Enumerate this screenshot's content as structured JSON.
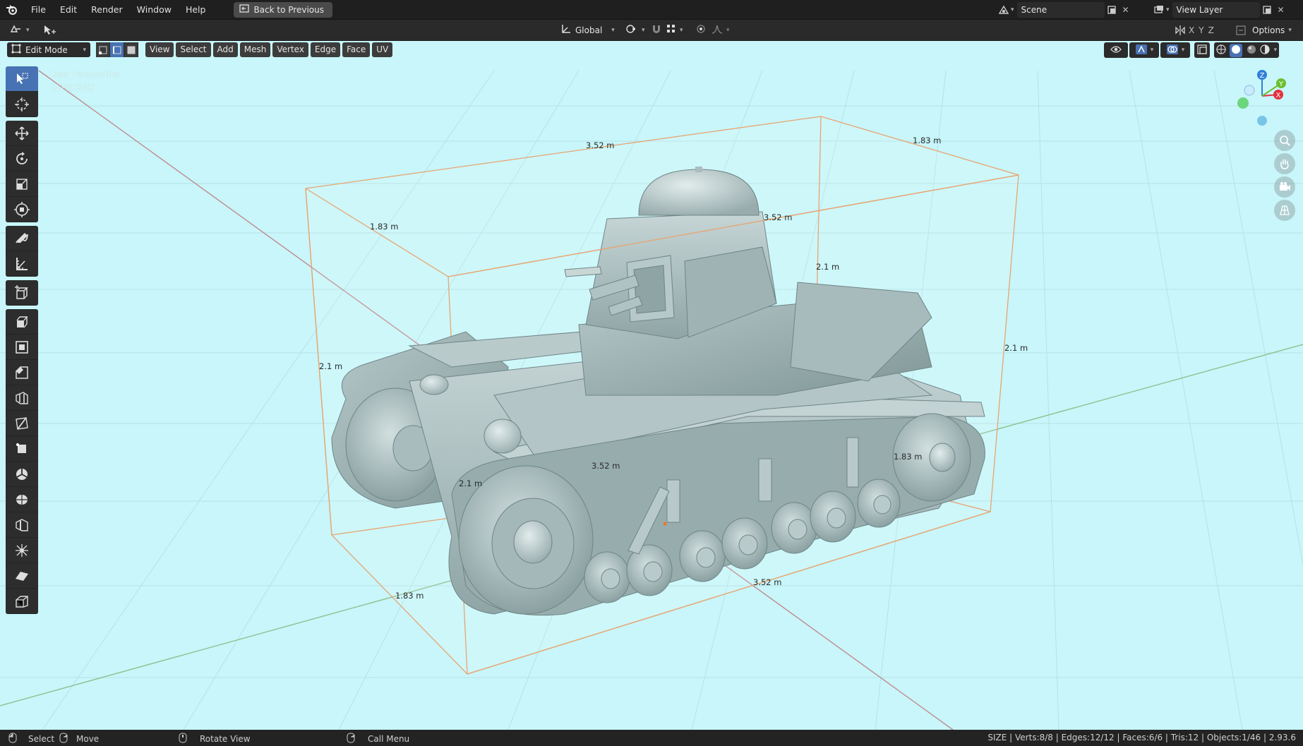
{
  "menu": {
    "items": [
      "File",
      "Edit",
      "Render",
      "Window",
      "Help"
    ],
    "back_button": "Back to Previous"
  },
  "scene": {
    "label": "Scene"
  },
  "view_layer": {
    "label": "View Layer"
  },
  "header": {
    "transform_orientation": "Global",
    "options_label": "Options",
    "axes": [
      "X",
      "Y",
      "Z"
    ]
  },
  "viewport": {
    "mode": "Edit Mode",
    "menus": [
      "View",
      "Select",
      "Add",
      "Mesh",
      "Vertex",
      "Edge",
      "Face",
      "UV"
    ],
    "info_line1": "User Perspective",
    "info_line2": "(126) SIZE",
    "background_color": "#c8f6fa",
    "gizmo": {
      "z": "Z",
      "y": "Y",
      "x": "X"
    }
  },
  "dimensions": [
    "3.52 m",
    "1.83 m",
    "1.83 m",
    "3.52 m",
    "2.1 m",
    "2.1 m",
    "2.1 m",
    "3.52 m",
    "2.1 m",
    "1.83 m",
    "3.52 m",
    "1.83 m"
  ],
  "status": {
    "select": "Select",
    "move": "Move",
    "rotate": "Rotate View",
    "call_menu": "Call Menu",
    "stats": "SIZE | Verts:8/8 | Edges:12/12 | Faces:6/6 | Tris:12 | Objects:1/46 | 2.93.6"
  }
}
